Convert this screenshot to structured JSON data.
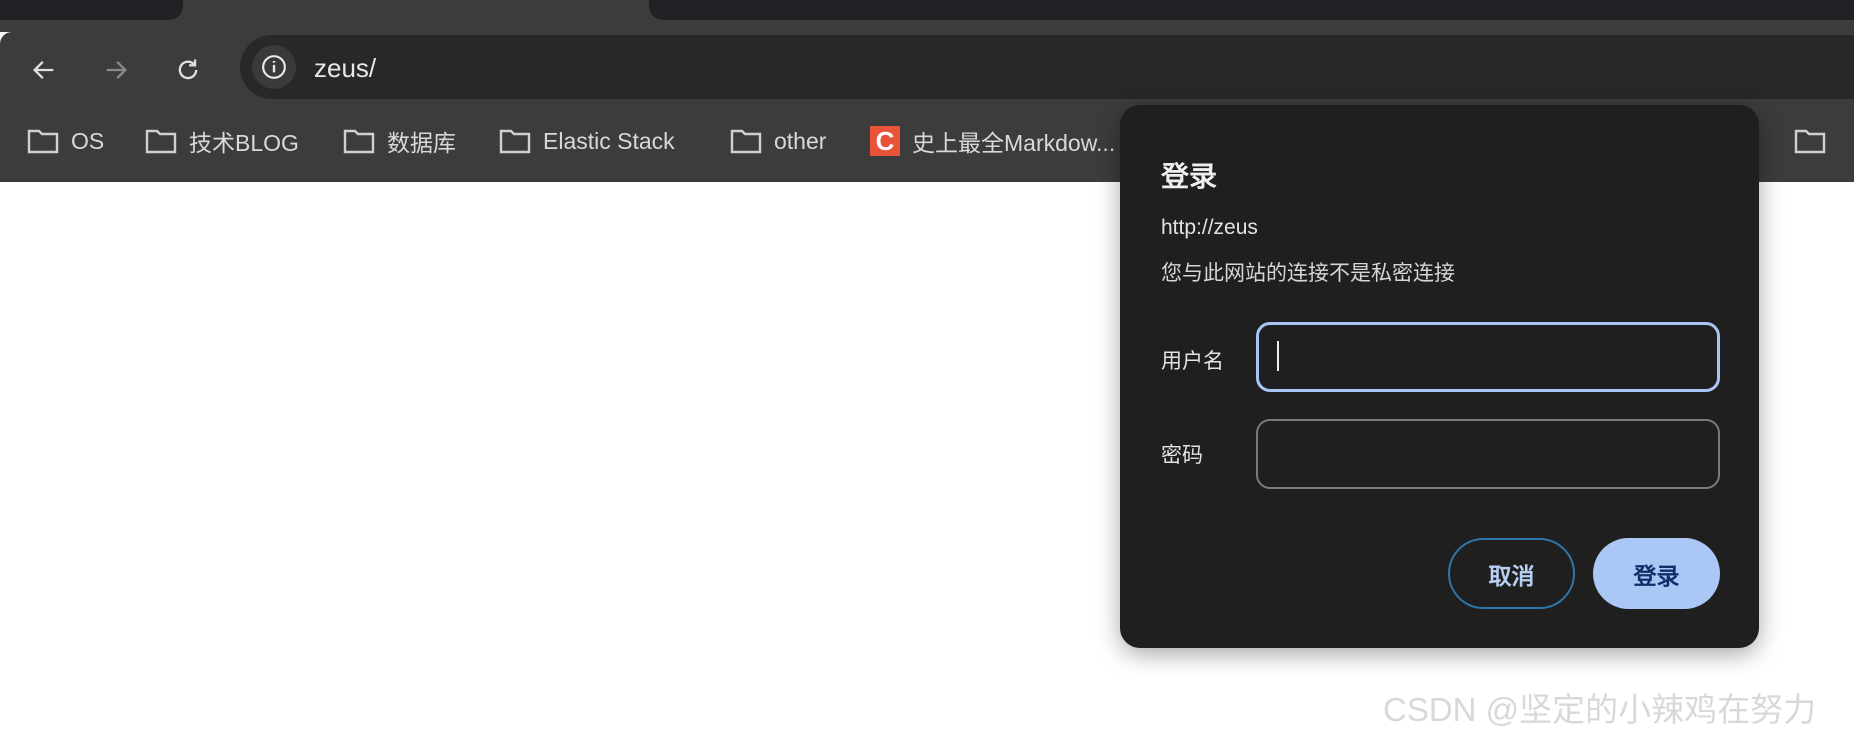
{
  "browser": {
    "url": "zeus/",
    "bookmarks": [
      {
        "label": "OS",
        "icon": "folder-icon"
      },
      {
        "label": "技术BLOG",
        "icon": "folder-icon"
      },
      {
        "label": "数据库",
        "icon": "folder-icon"
      },
      {
        "label": "Elastic Stack",
        "icon": "folder-icon"
      },
      {
        "label": "other",
        "icon": "folder-icon"
      },
      {
        "label": "史上最全Markdow...",
        "icon": "csdn-icon"
      }
    ],
    "csdn_icon_letter": "C"
  },
  "dialog": {
    "title": "登录",
    "origin": "http://zeus",
    "warning": "您与此网站的连接不是私密连接",
    "username_label": "用户名",
    "username_value": "",
    "password_label": "密码",
    "password_value": "",
    "cancel_label": "取消",
    "submit_label": "登录"
  },
  "watermark": "CSDN @坚定的小辣鸡在努力",
  "colors": {
    "accent": "#abc7f6",
    "focus_border": "#a8c4f5",
    "dialog_bg": "#1f1f1f"
  }
}
